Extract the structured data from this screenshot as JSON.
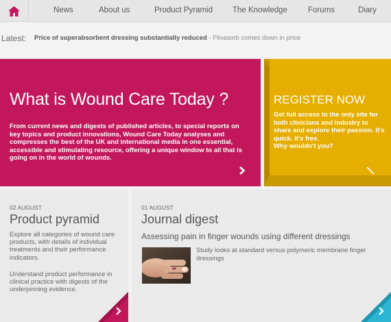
{
  "nav": {
    "items": [
      "News",
      "About us",
      "Product Pyramid",
      "The Knowledge",
      "Forums",
      "Diary"
    ]
  },
  "latest": {
    "label": "Latest:",
    "headline_bold": "Price of superabsorbent dressing substantially reduced",
    "headline_rest": " - Flivasorb comes down in price"
  },
  "hero": {
    "title": "What is Wound Care Today ?",
    "body": "From current news and digests of published articles, to special reports on key topics and product innovations, Wound Care Today analyses and compresses the best of the UK and international media in one essential, accessible and stimulating resource, offering a unique window to all that is going on in the world of wounds."
  },
  "register": {
    "title": "REGISTER NOW",
    "body": "Get full access to the only site for both clinicians and industry to share and explore their passion. It's quick. It's free.",
    "cta": "Why wouldn't you?"
  },
  "pyramid": {
    "date": "02 AUGUST",
    "title": "Product pyramid",
    "para1": "Explore all categories of wound care products, with details of individual treatments and their performance indicators.",
    "para2": "Understand product performance in clinical practice with digests of the underpinning evidence."
  },
  "digest": {
    "date": "01 AUGUST",
    "title": "Journal digest",
    "subtitle": "Assessing pain in finger wounds using different dressings",
    "study": "Study looks at standard versus polymeric membrane finger dressings"
  },
  "colors": {
    "magenta": "#c2185b",
    "yellow": "#e5ae00",
    "cyan": "#2ab6d2",
    "nav_bg": "#e6e6e6",
    "card_bg": "#eaeaea"
  },
  "icons": [
    "home-icon",
    "chevron-right-icon",
    "diagonal-arrow-icon"
  ]
}
